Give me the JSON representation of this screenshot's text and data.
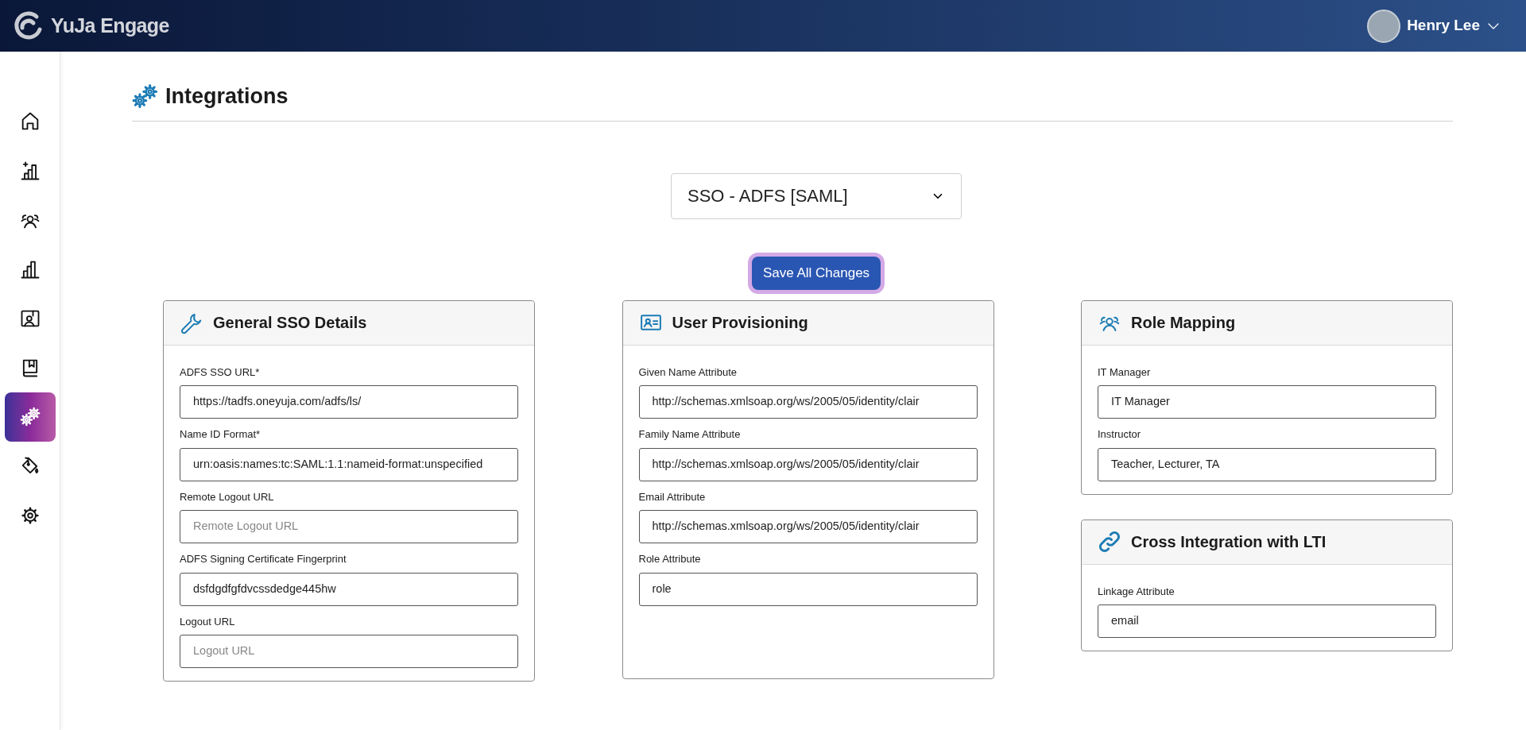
{
  "header": {
    "logo_text": "YuJa Engage",
    "user_name": "Henry Lee"
  },
  "sidebar": {
    "items": [
      {
        "selected": false
      },
      {
        "selected": false
      },
      {
        "selected": false
      },
      {
        "selected": false
      },
      {
        "selected": false
      },
      {
        "selected": false
      },
      {
        "selected": true
      },
      {
        "selected": false
      },
      {
        "selected": false
      }
    ]
  },
  "page": {
    "title": "Integrations"
  },
  "integration_select": {
    "value": "SSO - ADFS [SAML]"
  },
  "save_button": {
    "label": "Save All Changes"
  },
  "cards": [
    {
      "title": "General SSO Details",
      "fields": [
        {
          "label": "ADFS SSO URL*",
          "value": "https://tadfs.oneyuja.com/adfs/ls/"
        },
        {
          "label": "Name ID Format*",
          "value": "urn:oasis:names:tc:SAML:1.1:nameid-format:unspecified"
        },
        {
          "label": "Remote Logout URL",
          "placeholder": "Remote Logout URL"
        },
        {
          "label": "ADFS Signing Certificate Fingerprint",
          "value": "dsfdgdfgfdvcssdedge445hw"
        },
        {
          "label": "Logout URL",
          "placeholder": "Logout URL"
        }
      ]
    },
    {
      "title": "User Provisioning",
      "fields": [
        {
          "label": "Given Name Attribute",
          "value": "http://schemas.xmlsoap.org/ws/2005/05/identity/clair"
        },
        {
          "label": "Family Name Attribute",
          "value": "http://schemas.xmlsoap.org/ws/2005/05/identity/clair"
        },
        {
          "label": "Email Attribute",
          "value": "http://schemas.xmlsoap.org/ws/2005/05/identity/clair"
        },
        {
          "label": "Role Attribute",
          "value": "role"
        }
      ]
    },
    {
      "title": "Role Mapping",
      "fields": [
        {
          "label": "IT Manager",
          "value": "IT Manager"
        },
        {
          "label": "Instructor",
          "value": "Teacher, Lecturer, TA"
        }
      ]
    },
    {
      "title": "Cross Integration with LTI",
      "fields": [
        {
          "label": "Linkage Attribute",
          "value": "email"
        }
      ]
    }
  ]
}
